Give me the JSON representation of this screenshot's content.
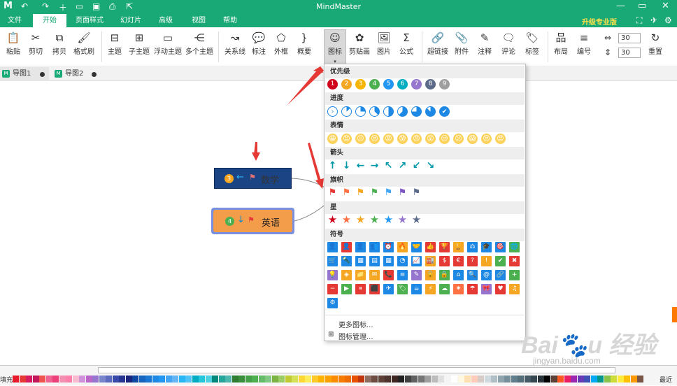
{
  "app": {
    "title": "MindMaster",
    "logo": "M"
  },
  "quick_access": [
    "undo-icon",
    "redo-icon",
    "new-icon",
    "open-icon",
    "save-icon",
    "print-icon",
    "export-icon"
  ],
  "menu": {
    "tabs": [
      "文件",
      "开始",
      "页面样式",
      "幻灯片",
      "高级",
      "视图",
      "帮助"
    ],
    "active": "开始",
    "upgrade": "升级专业版"
  },
  "ribbon": {
    "buttons": [
      {
        "label": "粘贴",
        "icon": "clipboard-icon",
        "glyph": "📋"
      },
      {
        "label": "剪切",
        "icon": "scissors-icon",
        "glyph": "✂"
      },
      {
        "label": "拷贝",
        "icon": "copy-icon",
        "glyph": "⧉"
      },
      {
        "label": "格式刷",
        "icon": "brush-icon",
        "glyph": "🖌"
      },
      {
        "label": "主题",
        "icon": "topic-icon",
        "glyph": "⊟"
      },
      {
        "label": "子主题",
        "icon": "subtopic-icon",
        "glyph": "⊞"
      },
      {
        "label": "浮动主题",
        "icon": "floating-topic-icon",
        "glyph": "▭"
      },
      {
        "label": "多个主题",
        "icon": "multi-topic-icon",
        "glyph": "⋲"
      },
      {
        "label": "关系线",
        "icon": "relation-icon",
        "glyph": "↝"
      },
      {
        "label": "标注",
        "icon": "callout-icon",
        "glyph": "💬"
      },
      {
        "label": "外框",
        "icon": "boundary-icon",
        "glyph": "⬠"
      },
      {
        "label": "概要",
        "icon": "summary-icon",
        "glyph": "}"
      },
      {
        "label": "图标",
        "icon": "icon-icon",
        "glyph": "☺"
      },
      {
        "label": "剪贴画",
        "icon": "clipart-icon",
        "glyph": "✿"
      },
      {
        "label": "图片",
        "icon": "picture-icon",
        "glyph": "🖼"
      },
      {
        "label": "公式",
        "icon": "formula-icon",
        "glyph": "Σ"
      },
      {
        "label": "超链接",
        "icon": "link-icon",
        "glyph": "🔗"
      },
      {
        "label": "附件",
        "icon": "attachment-icon",
        "glyph": "📎"
      },
      {
        "label": "注释",
        "icon": "note-icon",
        "glyph": "✎"
      },
      {
        "label": "评论",
        "icon": "comment-icon",
        "glyph": "🗨"
      },
      {
        "label": "标签",
        "icon": "tag-icon",
        "glyph": "🏷"
      },
      {
        "label": "布局",
        "icon": "layout-icon",
        "glyph": "品"
      },
      {
        "label": "编号",
        "icon": "numbering-icon",
        "glyph": "≡"
      },
      {
        "label": "重置",
        "icon": "reset-icon",
        "glyph": "↻"
      }
    ],
    "spacing_h": "30",
    "spacing_v": "30"
  },
  "doc_tabs": [
    {
      "label": "导图1"
    },
    {
      "label": "导图2"
    }
  ],
  "nodes": [
    {
      "text": "数学",
      "badge": "3",
      "badge_color": "#f5a623"
    },
    {
      "text": "英语",
      "badge": "4",
      "badge_color": "#4caf50"
    }
  ],
  "icon_panel": {
    "sections": [
      {
        "title": "优先级",
        "items": [
          "1",
          "2",
          "3",
          "4",
          "5",
          "6",
          "7",
          "8",
          "9"
        ],
        "colors": [
          "#d0021b",
          "#f5a623",
          "#f8b500",
          "#4caf50",
          "#2196f3",
          "#00acc1",
          "#9575cd",
          "#5c6b8a",
          "#9e9e9e"
        ]
      },
      {
        "title": "进度",
        "items": [
          "progress-0",
          "progress-1",
          "progress-2",
          "progress-3",
          "progress-4",
          "progress-5",
          "progress-6",
          "progress-7",
          "progress-done"
        ]
      },
      {
        "title": "表情",
        "items": [
          "😁",
          "😊",
          "😐",
          "😒",
          "😡",
          "😰",
          "😠",
          "😲",
          "😑",
          "😕",
          "😱",
          "😒",
          "😍"
        ]
      },
      {
        "title": "箭头",
        "items": [
          "↑",
          "↓",
          "←",
          "→",
          "↖",
          "↗",
          "↙",
          "↘"
        ],
        "color": "#0097a7"
      },
      {
        "title": "旗帜",
        "items": [
          "flag-red",
          "flag-orange",
          "flag-yellow",
          "flag-green",
          "flag-blue",
          "flag-purple",
          "flag-gray"
        ],
        "colors": [
          "#e53935",
          "#ff7043",
          "#f5a623",
          "#4caf50",
          "#42a5f5",
          "#7e57c2",
          "#5c6b8a"
        ]
      },
      {
        "title": "星",
        "items": [
          "★",
          "★",
          "★",
          "★",
          "★",
          "★",
          "★"
        ],
        "colors": [
          "#d0021b",
          "#ff7043",
          "#f5a623",
          "#4caf50",
          "#2196f3",
          "#9575cd",
          "#5c6b8a"
        ]
      },
      {
        "title": "符号",
        "items": [
          "👤",
          "👤",
          "👤",
          "👥",
          "⏰",
          "🔥",
          "🤝",
          "👍",
          "🏆",
          "🏆",
          "⚖",
          "🎓",
          "🎯",
          "🌐",
          "🛒",
          "🔦",
          "▦",
          "▤",
          "▦",
          "◔",
          "📈",
          "🏭",
          "$",
          "€",
          "?",
          "!",
          "✔",
          "✖",
          "💡",
          "◈",
          "📁",
          "✉",
          "📞",
          "≡",
          "✎",
          "🔓",
          "🔒",
          "⌂",
          "🔍",
          "@",
          "🔗",
          "+",
          "−",
          "▶",
          "⏸",
          "⬛",
          "✈",
          "🏷",
          "☕",
          "⚡",
          "☁",
          "✷",
          "☂",
          "🎀",
          "♥",
          "♫",
          "⚙"
        ],
        "colors": [
          "#1e88e5",
          "#e53935",
          "#1e88e5",
          "#1e88e5",
          "#1e88e5",
          "#f5a623",
          "#1e88e5",
          "#e53935",
          "#e53935",
          "#f5a623",
          "#1e88e5",
          "#1e88e5",
          "#1e88e5",
          "#4caf50",
          "#1e88e5",
          "#1e88e5",
          "#1e88e5",
          "#1e88e5",
          "#1e88e5",
          "#1e88e5",
          "#1e88e5",
          "#f5a623",
          "#e53935",
          "#e53935",
          "#e53935",
          "#f5a623",
          "#4caf50",
          "#e53935",
          "#9575cd",
          "#f5a623",
          "#f5a623",
          "#f5a623",
          "#e53935",
          "#1e88e5",
          "#9575cd",
          "#f5a623",
          "#4caf50",
          "#1e88e5",
          "#1e88e5",
          "#1e88e5",
          "#1e88e5",
          "#4caf50",
          "#e53935",
          "#4caf50",
          "#e53935",
          "#e53935",
          "#1e88e5",
          "#4caf50",
          "#1e88e5",
          "#f5a623",
          "#4caf50",
          "#ff7043",
          "#e53935",
          "#9575cd",
          "#e53935",
          "#f5a623",
          "#1e88e5"
        ]
      }
    ],
    "more_icons": "更多图标...",
    "manage_icons": "图标管理..."
  },
  "status": {
    "left": "填充",
    "right": "最近"
  },
  "watermark": {
    "brand": "Bai du 经验",
    "url": "jingyan.baidu.com"
  },
  "palette": [
    "#e8192c",
    "#e53935",
    "#d81b60",
    "#c2185b",
    "#ef5350",
    "#f06292",
    "#ec407a",
    "#f48fb1",
    "#ff80ab",
    "#f8bbd0",
    "#ce93d8",
    "#ba68c8",
    "#9575cd",
    "#7986cb",
    "#5c6bc0",
    "#3949ab",
    "#283593",
    "#1a237e",
    "#0d47a1",
    "#1565c0",
    "#1976d2",
    "#1e88e5",
    "#2196f3",
    "#42a5f5",
    "#64b5f6",
    "#29b6f6",
    "#4fc3f7",
    "#00acc1",
    "#26c6da",
    "#4dd0e1",
    "#00897b",
    "#26a69a",
    "#4db6ac",
    "#2e7d32",
    "#388e3c",
    "#43a047",
    "#4caf50",
    "#66bb6a",
    "#81c784",
    "#7cb342",
    "#9ccc65",
    "#c0ca33",
    "#d4e157",
    "#fdd835",
    "#ffee58",
    "#ffca28",
    "#ffb300",
    "#ffa000",
    "#fb8c00",
    "#f57c00",
    "#ef6c00",
    "#e65100",
    "#bf360c",
    "#8d6e63",
    "#6d4c41",
    "#5d4037",
    "#4e342e",
    "#3e2723",
    "#212121",
    "#424242",
    "#616161",
    "#757575",
    "#9e9e9e",
    "#bdbdbd",
    "#e0e0e0",
    "#f5f5f5",
    "#ffffff",
    "#fff8e1",
    "#ffe0b2",
    "#ffccbc",
    "#d7ccc8",
    "#cfd8dc",
    "#b0bec5",
    "#90a4ae",
    "#78909c",
    "#607d8b",
    "#546e7a",
    "#455a64",
    "#37474f",
    "#263238",
    "#000000",
    "#5d4037",
    "#ff5722",
    "#e91e63",
    "#9c27b0",
    "#673ab7",
    "#3f51b5",
    "#03a9f4",
    "#009688",
    "#8bc34a",
    "#cddc39",
    "#ffeb3b",
    "#ffc107",
    "#ff9800",
    "#795548"
  ]
}
